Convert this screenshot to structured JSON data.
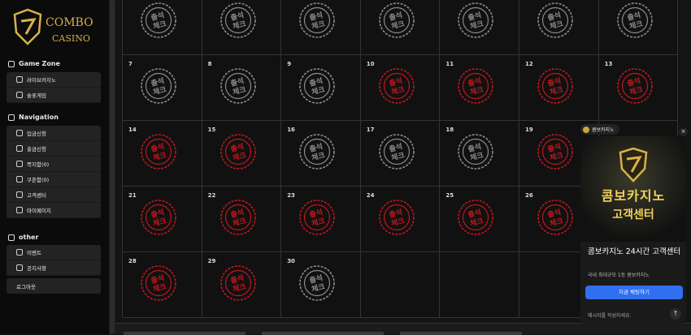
{
  "brand": {
    "logo_line1": "COMBO",
    "logo_line2": "CASINO"
  },
  "sidebar": {
    "sections": [
      {
        "title": "Game Zone",
        "items": [
          {
            "label": "라이브카지노",
            "icon": "cards-icon"
          },
          {
            "label": "슬롯게임",
            "icon": "slot-icon"
          }
        ]
      },
      {
        "title": "Navigation",
        "items": [
          {
            "label": "입금신청",
            "icon": "deposit-icon"
          },
          {
            "label": "출금신청",
            "icon": "withdraw-icon"
          },
          {
            "label": "쪽지함(0)",
            "icon": "mail-icon"
          },
          {
            "label": "쿠폰함(0)",
            "icon": "coupon-icon"
          },
          {
            "label": "고객센터",
            "icon": "headset-icon"
          },
          {
            "label": "마이페이지",
            "icon": "gear-icon"
          }
        ]
      },
      {
        "title": "other",
        "items": [
          {
            "label": "이벤트",
            "icon": "event-icon"
          },
          {
            "label": "공지사항",
            "icon": "notice-icon"
          }
        ]
      }
    ],
    "logout_label": "로그아웃"
  },
  "calendar": {
    "stamp_top": "출석",
    "stamp_bottom": "체크",
    "days": [
      {
        "day": "",
        "state": "unchecked"
      },
      {
        "day": "",
        "state": "unchecked"
      },
      {
        "day": "",
        "state": "unchecked"
      },
      {
        "day": "",
        "state": "unchecked"
      },
      {
        "day": "",
        "state": "unchecked"
      },
      {
        "day": "",
        "state": "unchecked"
      },
      {
        "day": "",
        "state": "unchecked"
      },
      {
        "day": "7",
        "state": "unchecked"
      },
      {
        "day": "8",
        "state": "unchecked"
      },
      {
        "day": "9",
        "state": "unchecked"
      },
      {
        "day": "10",
        "state": "checked"
      },
      {
        "day": "11",
        "state": "checked"
      },
      {
        "day": "12",
        "state": "checked"
      },
      {
        "day": "13",
        "state": "checked"
      },
      {
        "day": "14",
        "state": "checked"
      },
      {
        "day": "15",
        "state": "checked"
      },
      {
        "day": "16",
        "state": "unchecked"
      },
      {
        "day": "17",
        "state": "unchecked"
      },
      {
        "day": "18",
        "state": "unchecked"
      },
      {
        "day": "19",
        "state": "checked"
      },
      {
        "day": "",
        "state": "hidden"
      },
      {
        "day": "21",
        "state": "checked"
      },
      {
        "day": "22",
        "state": "checked"
      },
      {
        "day": "23",
        "state": "checked"
      },
      {
        "day": "24",
        "state": "checked"
      },
      {
        "day": "25",
        "state": "checked"
      },
      {
        "day": "26",
        "state": "checked"
      },
      {
        "day": "",
        "state": "hidden"
      },
      {
        "day": "28",
        "state": "checked"
      },
      {
        "day": "29",
        "state": "checked"
      },
      {
        "day": "30",
        "state": "unchecked"
      },
      {
        "day": "",
        "state": "empty"
      },
      {
        "day": "",
        "state": "empty"
      },
      {
        "day": "",
        "state": "empty"
      },
      {
        "day": "",
        "state": "empty"
      }
    ]
  },
  "chat": {
    "pill_label": "콤보카지노",
    "close_symbol": "×",
    "banner_line1": "콤보카지노",
    "banner_line2": "고객센터",
    "title": "콤보카지노 24시간 고객센터",
    "subtitle": "국내 최대규모 1등 콤보카지노",
    "button_label": "지금 채팅하기",
    "input_placeholder": "메시지를 작성하세요.",
    "send_symbol": "↑"
  },
  "colors": {
    "checked": "#c0161d",
    "unchecked": "#8a8a8a",
    "accent": "#2f6ff0",
    "gold": "#d8b14a"
  }
}
